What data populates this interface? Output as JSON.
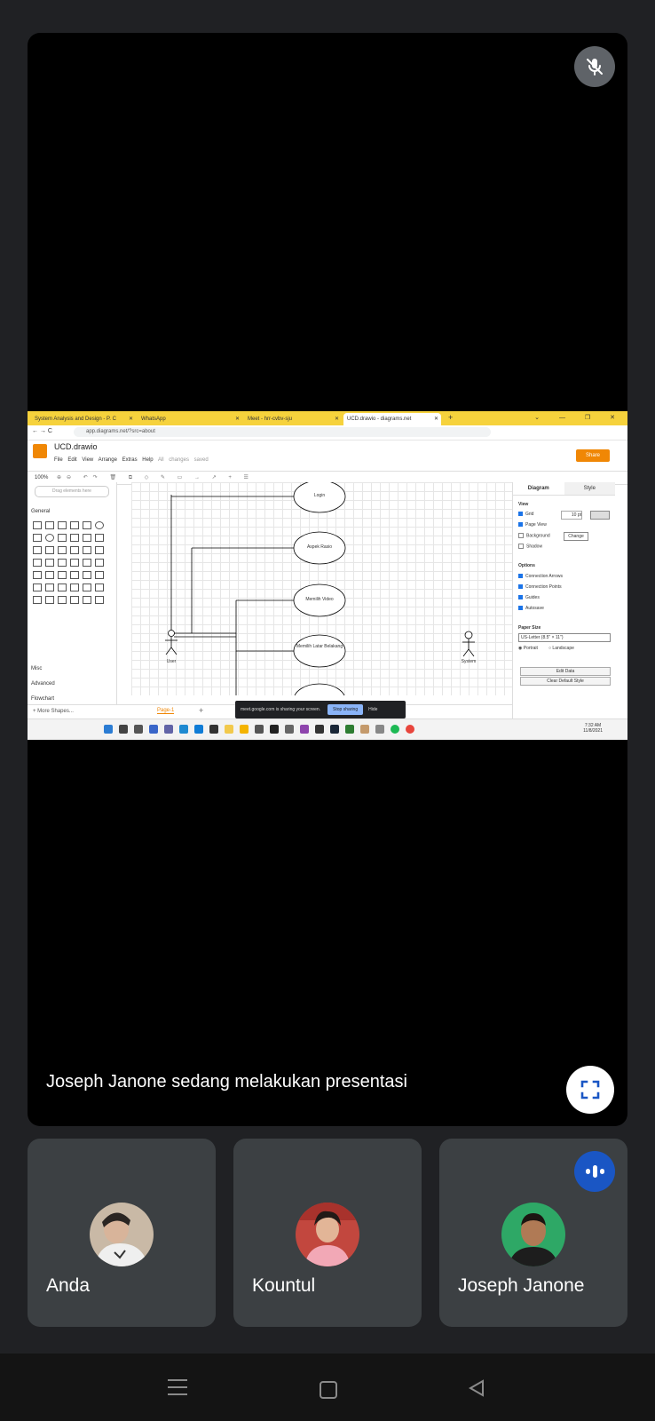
{
  "stage": {
    "presenting_text": "Joseph Janone sedang melakukan presentasi",
    "mic_icon": "mic-off-icon",
    "fullscreen_icon": "fullscreen-icon"
  },
  "shared_screen": {
    "tabs": [
      {
        "label": "System Analysis and Design - P. C"
      },
      {
        "label": "WhatsApp"
      },
      {
        "label": "Meet - hrr-cvbv-sju"
      },
      {
        "label": "UCD.drawio - diagrams.net"
      }
    ],
    "url": "app.diagrams.net/?src=about",
    "app": {
      "title": "UCD.drawio",
      "menus": "File  Edit  View  Arrange  Extras  Help",
      "saved_status": "All changes saved",
      "share_label": "Share",
      "zoom": "100%"
    },
    "left_panel": {
      "search_placeholder": "Drag elements here",
      "general": "General",
      "misc": "Misc",
      "advanced": "Advanced",
      "flowchart": "Flowchart",
      "more_shapes": "+ More Shapes..."
    },
    "diagram": {
      "use_cases": [
        "Login",
        "Aspek Rasio",
        "Memilih Video",
        "Memilih Latar Belakang"
      ],
      "actor_user": "User",
      "actor_system": "System"
    },
    "right_panel": {
      "tab_diagram": "Diagram",
      "tab_style": "Style",
      "view": "View",
      "grid": "Grid",
      "grid_size": "10 pt",
      "page_view": "Page View",
      "background": "Background",
      "change": "Change",
      "shadow": "Shadow",
      "options": "Options",
      "connection_arrows": "Connection Arrows",
      "connection_points": "Connection Points",
      "guides": "Guides",
      "autosave": "Autosave",
      "paper_size": "Paper Size",
      "paper_value": "US-Letter (8.5\" × 11\")",
      "portrait": "Portrait",
      "landscape": "Landscape",
      "edit_data": "Edit Data",
      "clear_default_style": "Clear Default Style"
    },
    "page_tab": "Page-1",
    "share_banner": {
      "text": "meet.google.com is sharing your screen.",
      "stop": "Stop sharing",
      "hide": "Hide"
    },
    "taskbar": {
      "time": "7:32 AM",
      "date": "11/8/2021"
    }
  },
  "participants": [
    {
      "name": "Anda"
    },
    {
      "name": "Kountul"
    },
    {
      "name": "Joseph Janone"
    }
  ]
}
